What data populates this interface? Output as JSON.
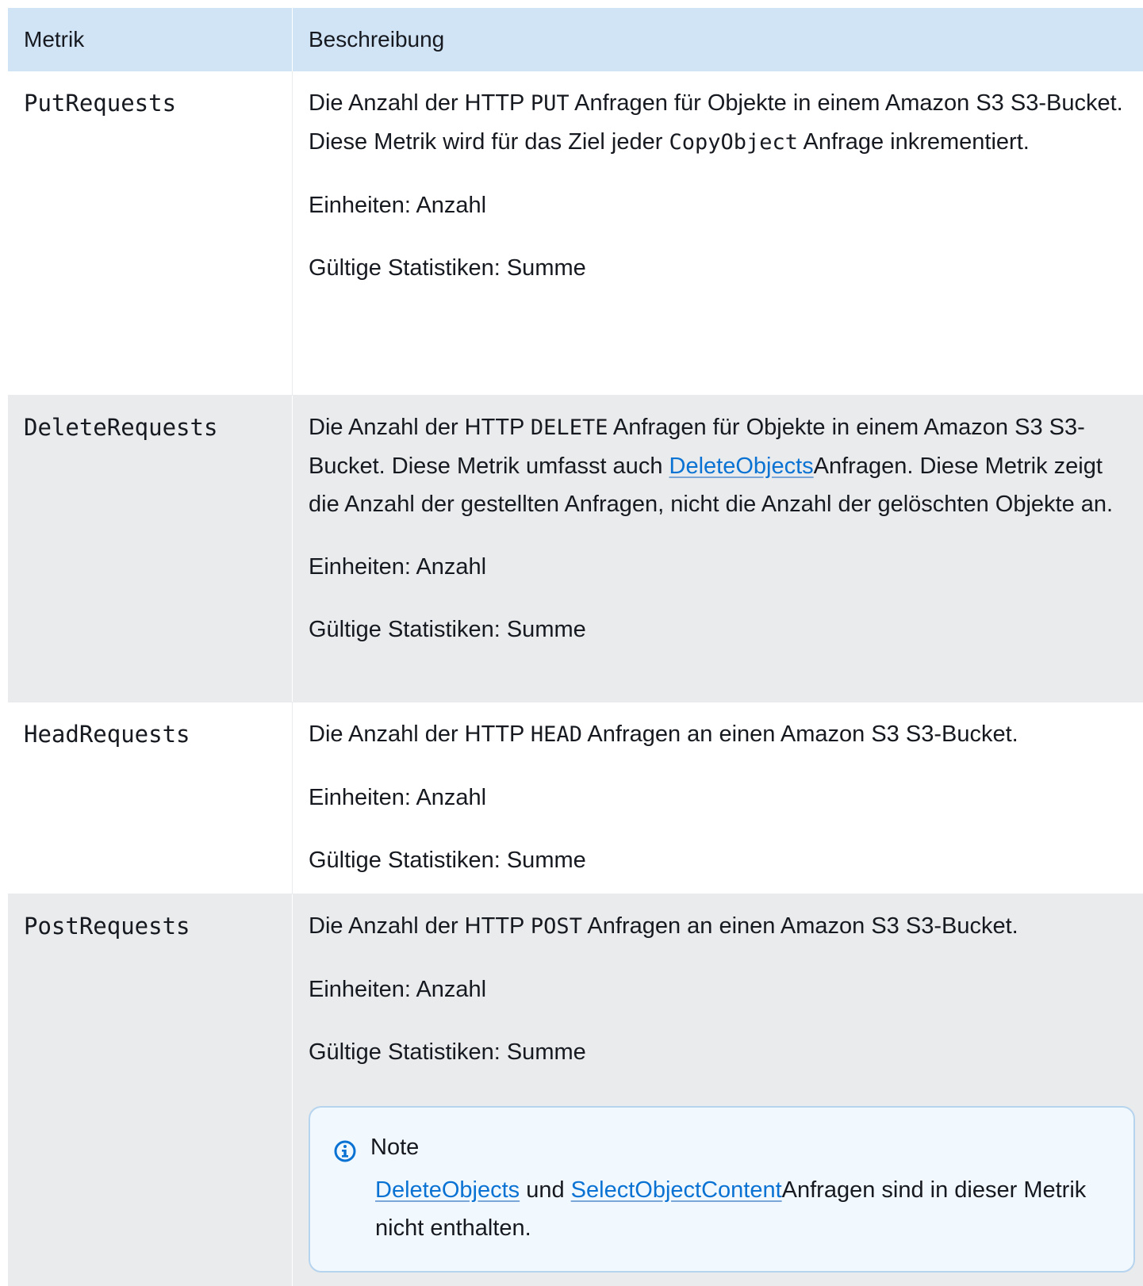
{
  "header": {
    "metric": "Metrik",
    "description": "Beschreibung"
  },
  "rows": [
    {
      "metric": "PutRequests",
      "desc_parts": [
        "Die Anzahl der HTTP ",
        "PUT",
        " Anfragen für Objekte in einem Amazon S3 S3-Bucket. Diese Metrik wird für das Ziel jeder ",
        "CopyObject",
        "  Anfrage inkrementiert."
      ],
      "units": "Einheiten: Anzahl",
      "stats": "Gültige Statistiken: Summe"
    },
    {
      "metric": "DeleteRequests",
      "desc_parts": [
        "Die Anzahl der HTTP ",
        "DELETE",
        " Anfragen für Objekte in einem Amazon S3 S3-Bucket. Diese Metrik umfasst auch ",
        "DeleteObjects",
        "Anfragen. Diese Metrik zeigt die Anzahl der gestellten Anfragen, nicht die Anzahl der gelöschten Objekte an."
      ],
      "units": "Einheiten: Anzahl",
      "stats": "Gültige Statistiken: Summe"
    },
    {
      "metric": "HeadRequests",
      "desc_parts": [
        "Die Anzahl der HTTP ",
        "HEAD",
        " Anfragen an einen Amazon S3 S3-Bucket."
      ],
      "units": "Einheiten: Anzahl",
      "stats": "Gültige Statistiken: Summe"
    },
    {
      "metric": "PostRequests",
      "desc_parts": [
        "Die Anzahl der HTTP ",
        "POST",
        " Anfragen an einen Amazon S3 S3-Bucket."
      ],
      "units": "Einheiten: Anzahl",
      "stats": "Gültige Statistiken: Summe"
    }
  ],
  "note": {
    "icon": "info-icon",
    "title": "Note",
    "link1": "DeleteObjects",
    "mid": " und ",
    "link2": "SelectObjectContent",
    "tail": "Anfragen sind in dieser Metrik nicht enthalten."
  },
  "colors": {
    "header_bg": "#d1e4f5",
    "shaded_row": "#e9ebed",
    "link": "#0972d3",
    "note_bg": "#f1f8fe",
    "note_border": "#b7d4ee"
  }
}
